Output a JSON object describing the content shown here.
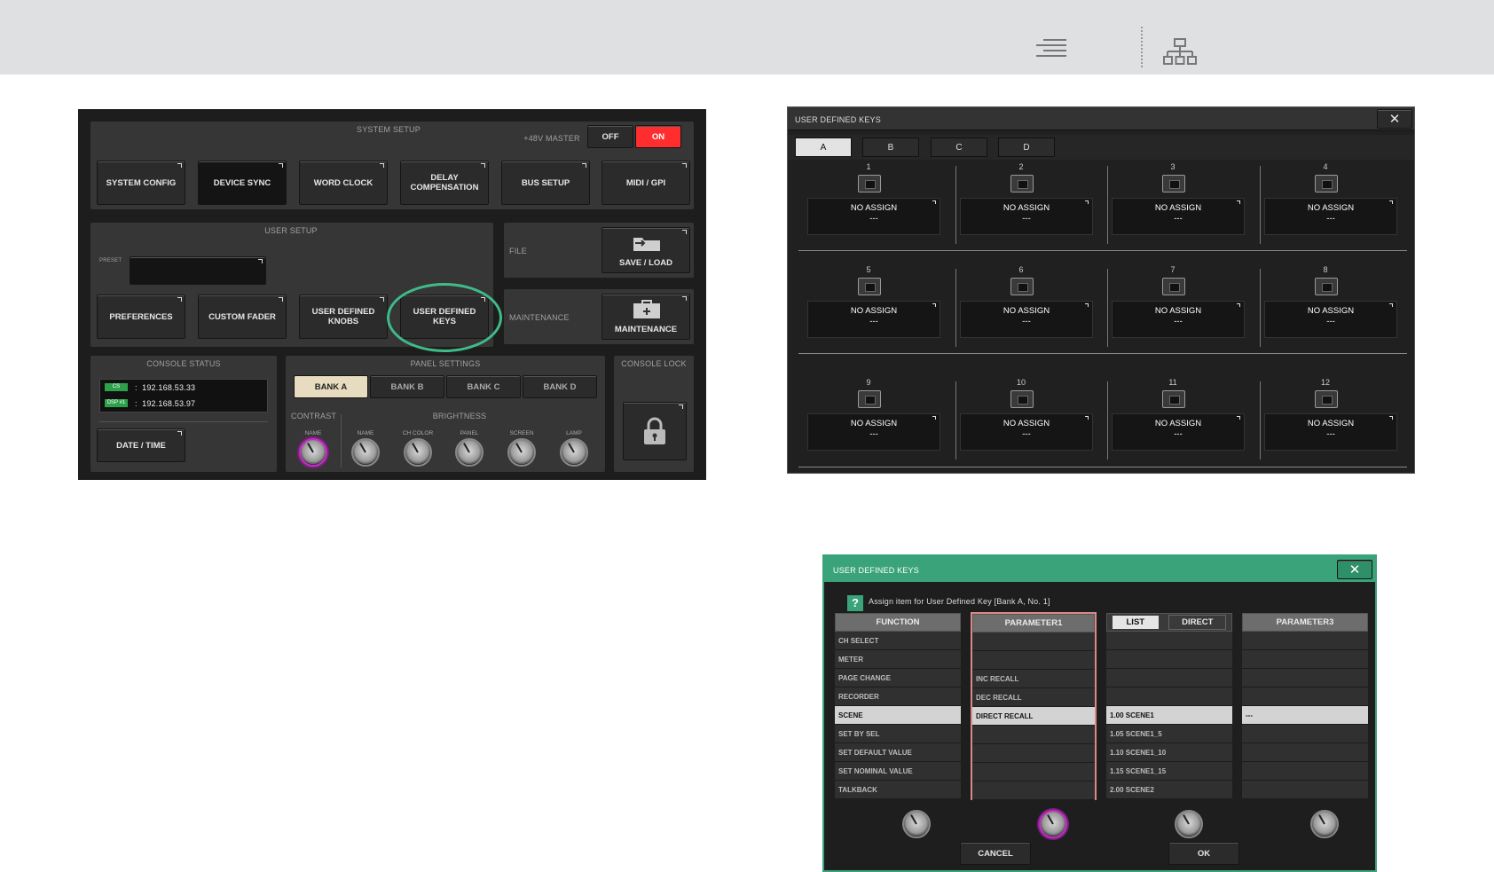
{
  "toolbar": {
    "align_icon": "align-right-icon",
    "sitemap_icon": "sitemap-icon"
  },
  "setup": {
    "system_setup_caption": "SYSTEM SETUP",
    "phantom_label": "+48V MASTER",
    "off_label": "OFF",
    "on_label": "ON",
    "system_buttons": [
      "SYSTEM CONFIG",
      "DEVICE SYNC",
      "WORD CLOCK",
      "DELAY\nCOMPENSATION",
      "BUS SETUP",
      "MIDI / GPI"
    ],
    "user_setup_caption": "USER SETUP",
    "preset_label": "PRESET",
    "user_buttons": [
      "PREFERENCES",
      "CUSTOM FADER",
      "USER DEFINED\nKNOBS",
      "USER DEFINED\nKEYS"
    ],
    "file_label": "FILE",
    "save_load_label": "SAVE / LOAD",
    "maintenance_label": "MAINTENANCE",
    "maintenance_button": "MAINTENANCE",
    "console_status_caption": "CONSOLE STATUS",
    "cs_chip": "CS",
    "cs_ip": "192.168.53.33",
    "dsp_chip": "DSP #1",
    "dsp_ip": "192.168.53.97",
    "date_time_label": "DATE / TIME",
    "panel_settings_caption": "PANEL SETTINGS",
    "banks": [
      "BANK A",
      "BANK B",
      "BANK C",
      "BANK D"
    ],
    "contrast_label": "CONTRAST",
    "brightness_label": "BRIGHTNESS",
    "knob_labels": [
      "NAME",
      "NAME",
      "CH COLOR",
      "PANEL",
      "SCREEN",
      "LAMP"
    ],
    "console_lock_caption": "CONSOLE LOCK"
  },
  "udk": {
    "title": "USER DEFINED KEYS",
    "close_icon": "close-icon",
    "tabs": [
      "A",
      "B",
      "C",
      "D"
    ],
    "key_numbers": [
      "1",
      "2",
      "3",
      "4",
      "5",
      "6",
      "7",
      "8",
      "9",
      "10",
      "11",
      "12"
    ],
    "assign_text": "NO ASSIGN",
    "assign_sub": "---"
  },
  "assign": {
    "title": "USER DEFINED KEYS",
    "help_icon": "?",
    "prompt": "Assign item for User Defined Key [Bank A, No. 1]",
    "function_header": "FUNCTION",
    "function_rows": [
      "CH SELECT",
      "METER",
      "PAGE CHANGE",
      "RECORDER",
      "SCENE",
      "SET BY SEL",
      "SET DEFAULT VALUE",
      "SET NOMINAL VALUE",
      "TALKBACK"
    ],
    "param1_header": "PARAMETER1",
    "param1_rows": [
      "",
      "",
      "INC RECALL",
      "DEC RECALL",
      "DIRECT RECALL",
      "",
      "",
      "",
      ""
    ],
    "list_label": "LIST",
    "direct_label": "DIRECT",
    "param2_rows": [
      "",
      "",
      "",
      "",
      "1.00 SCENE1",
      "1.05 SCENE1_5",
      "1.10 SCENE1_10",
      "1.15 SCENE1_15",
      "2.00 SCENE2"
    ],
    "param3_header": "PARAMETER3",
    "param3_rows": [
      "",
      "",
      "",
      "",
      "---",
      "",
      "",
      "",
      ""
    ],
    "cancel_label": "CANCEL",
    "ok_label": "OK"
  }
}
